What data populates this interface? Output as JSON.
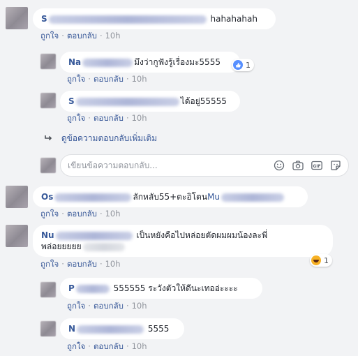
{
  "actions": {
    "like": "ถูกใจ",
    "reply": "ตอบกลับ",
    "dot": "·"
  },
  "comments": [
    {
      "name_start": "S",
      "text": "hahahahah",
      "time": "10h"
    },
    {
      "name_start": "Na",
      "text": "มึงว่ากูฟังรู้เรื่องมะ5555",
      "time": "10h",
      "reaction_count": "1"
    },
    {
      "name_start": "S",
      "text": "ได้อยู่55555",
      "time": "10h"
    },
    {
      "name_start": "Os",
      "text": "ลักหลับ55+ตะอิโตน",
      "mention_start": "Mu",
      "time": "10h"
    },
    {
      "name_start": "Nu",
      "text_line1": "เป็นหยังคือไปหล่อยตัดผมผมน้องละพี่",
      "text_line2": "พล่อยยยยย",
      "time": "10h",
      "reaction_count": "1"
    },
    {
      "name_start": "P",
      "text": "555555 ระวังตัวให้ดีนะเทออ่ะะะะ",
      "time": "10h"
    },
    {
      "name_start": "N",
      "text": "5555",
      "time": "10h"
    }
  ],
  "more_replies": "ดูข้อความตอบกลับเพิ่มเติม",
  "reply_box": {
    "placeholder": "เขียนข้อความตอบกลับ..."
  },
  "icons": {
    "reply_arrow": "reply-arrow-icon",
    "like": "like-icon",
    "haha": "haha-icon",
    "emoji": "emoji-icon",
    "camera": "camera-icon",
    "gif": "gif-icon",
    "sticker": "sticker-icon"
  },
  "colors": {
    "background": "#f2f3f5",
    "link": "#385898",
    "name": "#365899",
    "like": "#5890ff"
  }
}
